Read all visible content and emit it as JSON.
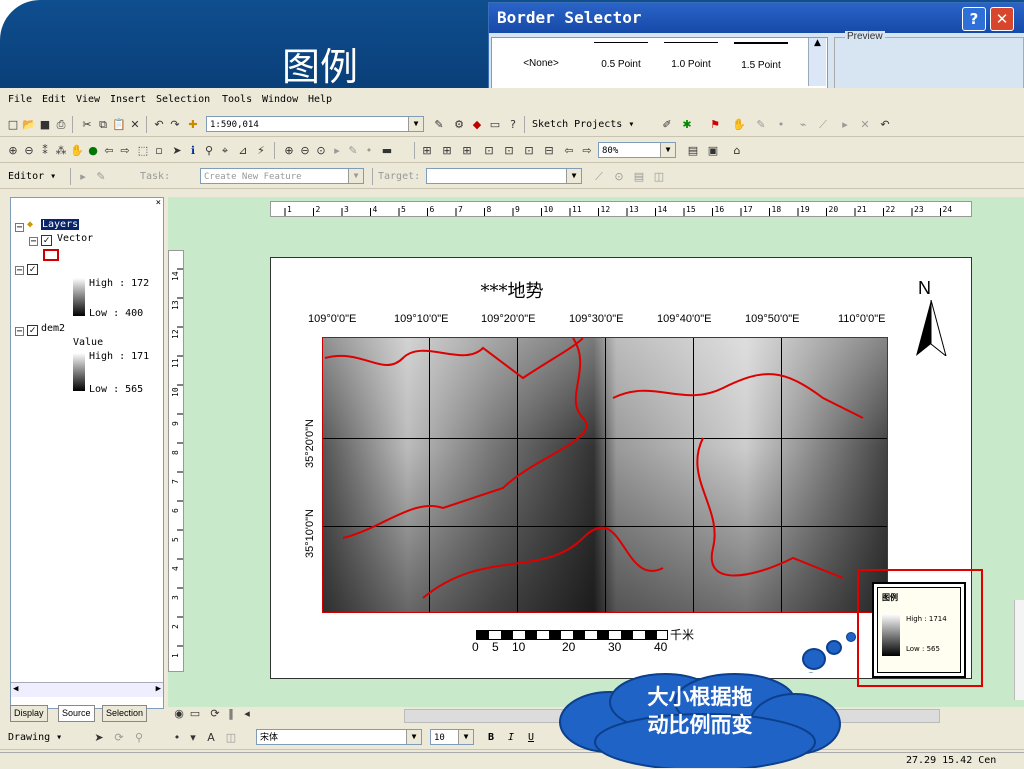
{
  "slide": {
    "title": "图例"
  },
  "dialog": {
    "title": "Border Selector",
    "help_glyph": "?",
    "close_glyph": "✕",
    "options": [
      "<None>",
      "0.5 Point",
      "1.0 Point",
      "1.5 Point"
    ],
    "preview_label": "Preview"
  },
  "menu": [
    "File",
    "Edit",
    "View",
    "Insert",
    "Selection",
    "Tools",
    "Window",
    "Help"
  ],
  "toolbar": {
    "scale": "1:590,014",
    "sketch_projects": "Sketch Projects ▾",
    "zoom_percent": "80%"
  },
  "editor": {
    "label": "Editor ▾",
    "task_label": "Task:",
    "task_value": "Create New Feature",
    "target_label": "Target:"
  },
  "toc": {
    "root": "Layers",
    "layers": [
      {
        "name": "Vector"
      },
      {
        "name": "",
        "high": "High : 172",
        "low": "Low : 400"
      },
      {
        "name": "dem2",
        "sub": "Value",
        "high": "High : 171",
        "low": "Low : 565"
      }
    ],
    "tabs": [
      "Display",
      "Source",
      "Selection"
    ]
  },
  "ruler": {
    "h": [
      "1",
      "2",
      "3",
      "4",
      "5",
      "6",
      "7",
      "8",
      "9",
      "10",
      "11",
      "12",
      "13",
      "14",
      "15",
      "16",
      "17",
      "18",
      "19",
      "20",
      "21",
      "22",
      "23",
      "24"
    ],
    "v": [
      "14",
      "13",
      "12",
      "11",
      "10",
      "9",
      "8",
      "7",
      "6",
      "5",
      "4",
      "3",
      "2",
      "1"
    ]
  },
  "map": {
    "title": "***地势",
    "north": "N",
    "lon_labels": [
      "109°0'0\"E",
      "109°10'0\"E",
      "109°20'0\"E",
      "109°30'0\"E",
      "109°40'0\"E",
      "109°50'0\"E",
      "110°0'0\"E"
    ],
    "lat_labels": [
      "35°20'0\"N",
      "35°10'0\"N"
    ],
    "scale_ticks": [
      "0",
      "5",
      "10",
      "20",
      "30",
      "40"
    ],
    "scale_unit": "千米"
  },
  "legend": {
    "title": "图例",
    "high": "High : 1714",
    "low": "Low : 565"
  },
  "callout": {
    "line1": "大小根据拖",
    "line2": "动比例而变"
  },
  "drawing": {
    "label": "Drawing ▾",
    "font": "宋体",
    "size": "10",
    "bold": "B",
    "italic": "I",
    "underline": "U"
  },
  "status": {
    "coords": "27.29  15.42 Cen"
  },
  "colors": {
    "banner": "#0f4e8f",
    "highlight": "#e00000",
    "callout": "#1f63c6",
    "layout_bg": "#c8eacb"
  }
}
